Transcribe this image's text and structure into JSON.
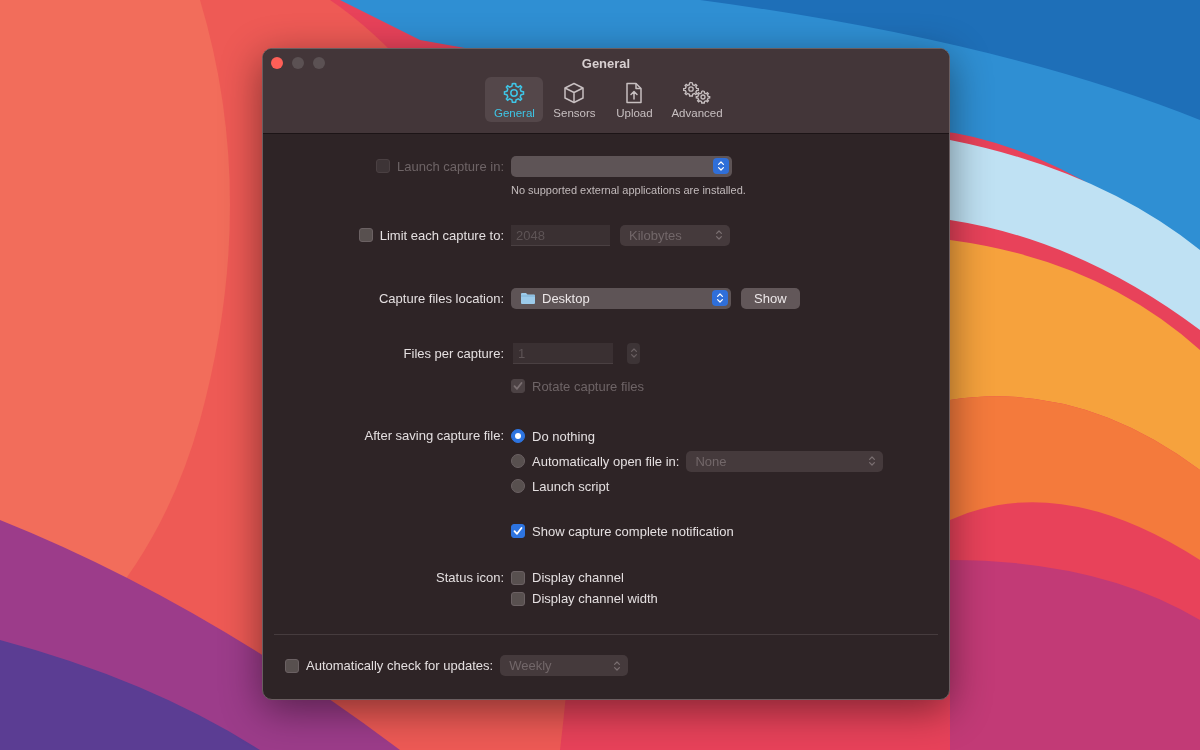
{
  "window": {
    "title": "General"
  },
  "tabs": [
    {
      "label": "General",
      "selected": true
    },
    {
      "label": "Sensors",
      "selected": false
    },
    {
      "label": "Upload",
      "selected": false
    },
    {
      "label": "Advanced",
      "selected": false
    }
  ],
  "launch_capture": {
    "label": "Launch capture in:",
    "checked": false,
    "disabled": true,
    "popup": {
      "disabled": false
    },
    "note": "No supported external applications are installed."
  },
  "limit_capture": {
    "label": "Limit each capture to:",
    "checked": false,
    "disabled": false,
    "field": {
      "value": "2048",
      "disabled": true
    },
    "unit_popup": {
      "value": "Kilobytes",
      "disabled": true
    }
  },
  "location": {
    "label": "Capture files location:",
    "popup": {
      "value": "Desktop",
      "disabled": false
    },
    "button": "Show"
  },
  "files_per_capture": {
    "label": "Files per capture:",
    "field": {
      "value": "1",
      "disabled": true
    },
    "stepper": {
      "disabled": true
    },
    "rotate": {
      "label": "Rotate capture files",
      "checked": true,
      "disabled": true
    }
  },
  "after_saving": {
    "label": "After saving capture file:",
    "options": [
      {
        "label": "Do nothing",
        "selected": true
      },
      {
        "label": "Automatically open file in:",
        "selected": false,
        "popup": {
          "value": "None",
          "disabled": true
        }
      },
      {
        "label": "Launch script",
        "selected": false
      }
    ]
  },
  "notification": {
    "label": "Show capture complete notification",
    "checked": true,
    "disabled": false
  },
  "status_icon": {
    "label": "Status icon:",
    "options": [
      {
        "label": "Display channel",
        "checked": false,
        "disabled": false
      },
      {
        "label": "Display channel width",
        "checked": false,
        "disabled": false
      }
    ]
  },
  "updates": {
    "label": "Automatically check for updates:",
    "checked": false,
    "disabled": false,
    "popup": {
      "value": "Weekly",
      "disabled": true
    }
  }
}
